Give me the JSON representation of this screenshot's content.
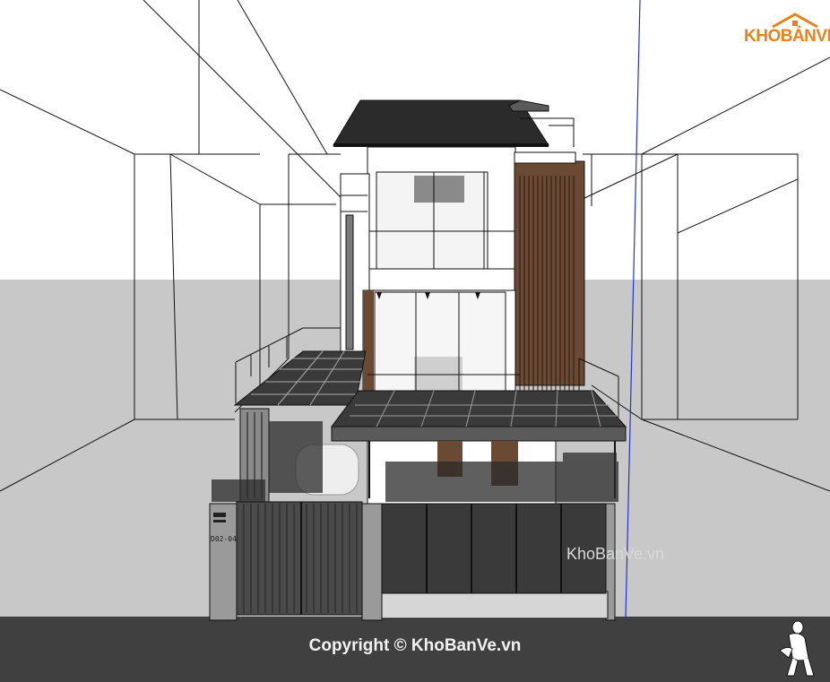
{
  "logo": {
    "text": "KHOBANVE",
    "display": "KHOBẢNVẼ",
    "color": "#e8821e"
  },
  "watermark": {
    "text": "KhoBanVe.vn"
  },
  "copyright": {
    "text": "Copyright © KhoBanVe.vn"
  },
  "house": {
    "plate_label": "D02-04"
  },
  "colors": {
    "ground": "#404040",
    "sky": "#ffffff",
    "horizon": "#c8c8c8",
    "wood": "#6b4a33",
    "roof": "#2b2b2b",
    "axis_blue": "#2233cc"
  },
  "icons": {
    "scale_figure": "human-scale-figure-icon"
  }
}
